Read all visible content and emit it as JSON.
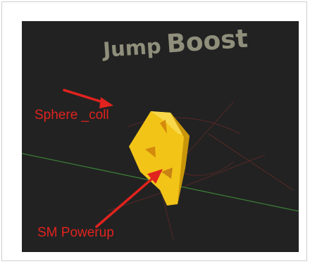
{
  "viewport": {
    "title_word_1": "Jump",
    "title_word_2": "Boost"
  },
  "annotations": {
    "sphere_label": "Sphere _coll",
    "powerup_label": "SM Powerup"
  },
  "colors": {
    "background": "#222222",
    "title_text": "#8f8f7c",
    "annotation": "#e0231e",
    "powerup_body": "#f2c418",
    "axis_x": "#3a7d36"
  },
  "icons": {
    "arrow": "red-arrow-icon",
    "mesh": "powerup-mesh-icon"
  }
}
